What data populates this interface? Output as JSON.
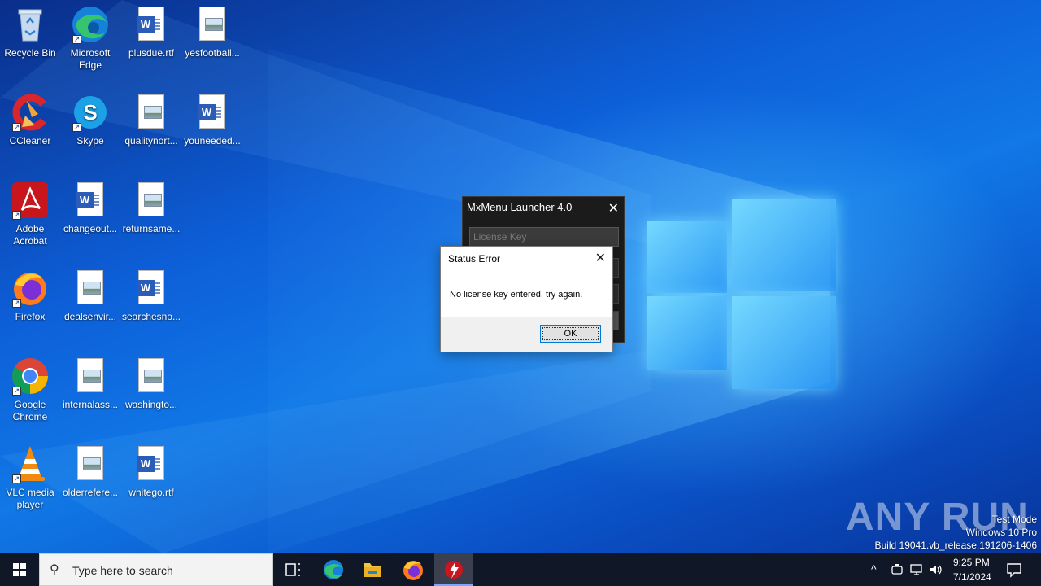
{
  "desktop": {
    "icons": [
      {
        "label": "Recycle Bin",
        "icon": "recycle-bin-icon"
      },
      {
        "label": "Microsoft Edge",
        "icon": "edge-icon"
      },
      {
        "label": "plusdue.rtf",
        "icon": "word-doc-icon"
      },
      {
        "label": "yesfootball...",
        "icon": "image-file-icon"
      },
      {
        "label": "CCleaner",
        "icon": "ccleaner-icon"
      },
      {
        "label": "Skype",
        "icon": "skype-icon"
      },
      {
        "label": "qualitynort...",
        "icon": "image-file-icon"
      },
      {
        "label": "youneeded...",
        "icon": "word-doc-icon"
      },
      {
        "label": "Adobe Acrobat",
        "icon": "acrobat-icon"
      },
      {
        "label": "changeout...",
        "icon": "word-doc-icon"
      },
      {
        "label": "returnsame...",
        "icon": "image-file-icon"
      },
      {
        "label": "Firefox",
        "icon": "firefox-icon"
      },
      {
        "label": "dealsenvir...",
        "icon": "image-file-icon"
      },
      {
        "label": "searchesno...",
        "icon": "word-doc-icon"
      },
      {
        "label": "Google Chrome",
        "icon": "chrome-icon"
      },
      {
        "label": "internalass...",
        "icon": "image-file-icon"
      },
      {
        "label": "washingto...",
        "icon": "image-file-icon"
      },
      {
        "label": "VLC media player",
        "icon": "vlc-icon"
      },
      {
        "label": "olderrefere...",
        "icon": "image-file-icon"
      },
      {
        "label": "whitego.rtf",
        "icon": "word-doc-icon"
      }
    ]
  },
  "launcher": {
    "title": "MxMenu Launcher 4.0",
    "close_glyph": "✕",
    "license_placeholder": "License Key"
  },
  "dialog": {
    "title": "Status Error",
    "close_glyph": "✕",
    "message": "No license key entered, try again.",
    "ok_label": "OK"
  },
  "watermark": {
    "text": "ANY RUN",
    "mode": "Test Mode",
    "os": "Windows 10 Pro",
    "build": "Build 19041.vb_release.191206-1406"
  },
  "taskbar": {
    "search_placeholder": "Type here to search",
    "time": "9:25 PM",
    "date": "7/1/2024",
    "chevron": "^"
  },
  "colors": {
    "taskbar_bg": "#101827",
    "launcher_bg": "#1b1b1b",
    "accent": "#0078d7"
  }
}
